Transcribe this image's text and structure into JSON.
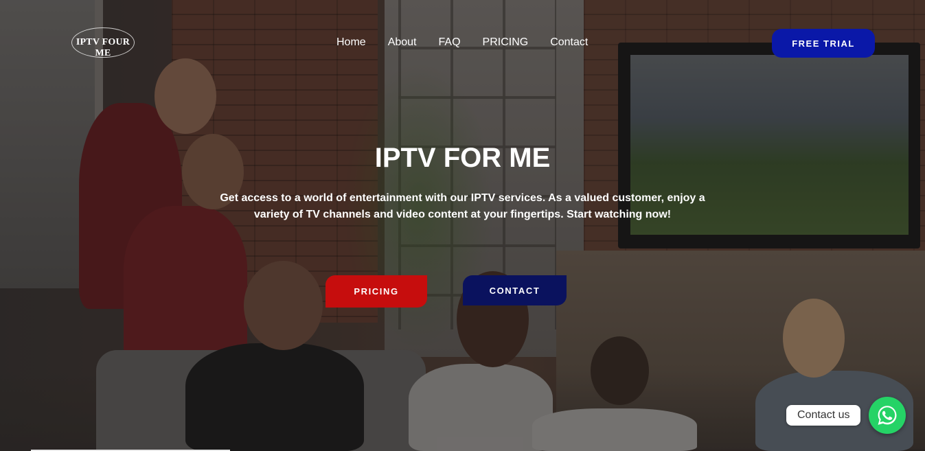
{
  "header": {
    "logo_text": "IPTV FOUR ME",
    "nav": [
      {
        "label": "Home"
      },
      {
        "label": "About"
      },
      {
        "label": "FAQ"
      },
      {
        "label": "PRICING"
      },
      {
        "label": "Contact"
      }
    ],
    "cta_label": "FREE TRIAL"
  },
  "hero": {
    "title": "IPTV FOR ME",
    "description": "Get access to a world of entertainment with our IPTV services. As a valued customer, enjoy a variety of TV channels and video content at your fingertips. Start watching now!",
    "primary_button": "PRICING",
    "secondary_button": "CONTACT"
  },
  "whatsapp": {
    "label": "Contact us",
    "icon": "whatsapp-icon"
  },
  "colors": {
    "trial_button": "#0a18a8",
    "pricing_button": "#c60d0d",
    "contact_button": "#0a125e",
    "whatsapp": "#25d366"
  }
}
